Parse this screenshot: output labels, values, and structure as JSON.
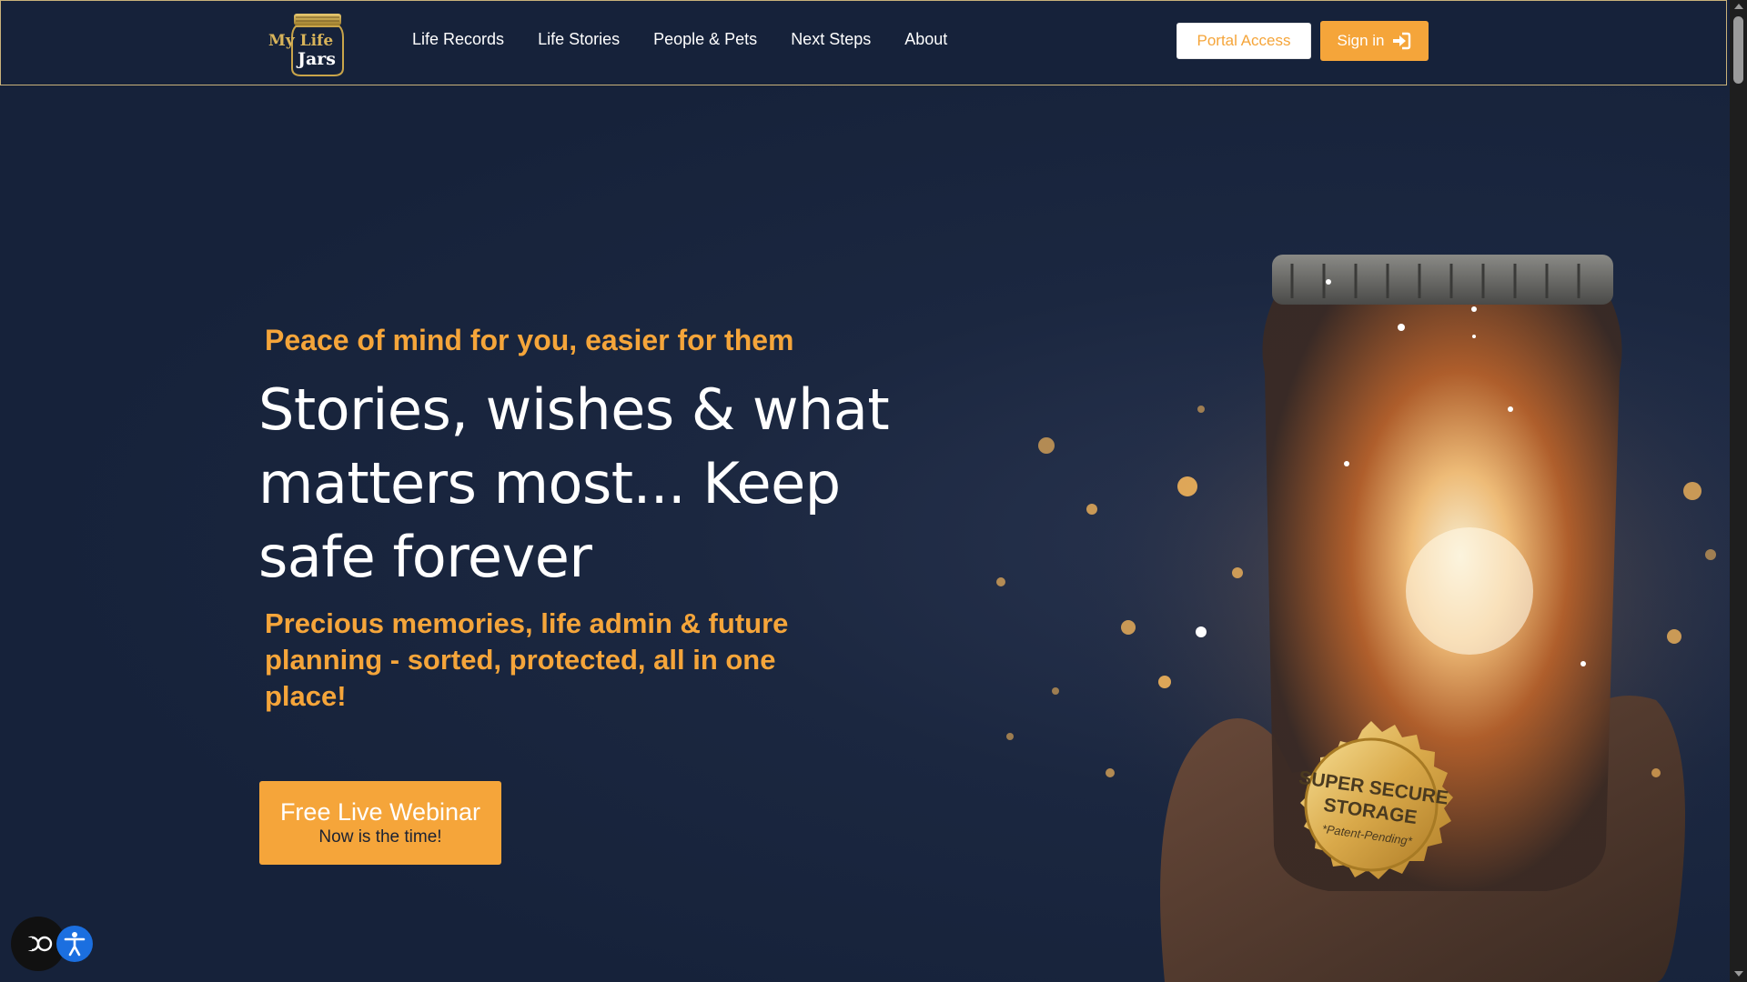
{
  "brand": {
    "logo_line1": "My Life",
    "logo_line2": "Jars"
  },
  "nav": {
    "items": [
      {
        "label": "Life Records"
      },
      {
        "label": "Life Stories"
      },
      {
        "label": "People & Pets"
      },
      {
        "label": "Next Steps"
      },
      {
        "label": "About"
      }
    ]
  },
  "header_actions": {
    "portal_label": "Portal Access",
    "signin_label": "Sign in",
    "signin_icon": "sign-in-icon"
  },
  "hero": {
    "tagline": "Peace of mind for you, easier for them",
    "headline": "Stories, wishes & what matters most... Keep safe forever",
    "subhead": "Precious memories, life admin & future planning - sorted, protected, all in one place!",
    "cta_title": "Free Live Webinar",
    "cta_sub": "Now is the time!"
  },
  "badge": {
    "line1": "SUPER SECURE",
    "line2": "STORAGE",
    "line3": "*Patent-Pending*"
  },
  "accessibility": {
    "eye_icon": "vision-icon",
    "person_icon": "accessibility-icon"
  },
  "colors": {
    "background": "#16223a",
    "accent": "#f5a53a",
    "header_border": "#c9b27a",
    "a11y_blue": "#1b6fe0"
  }
}
